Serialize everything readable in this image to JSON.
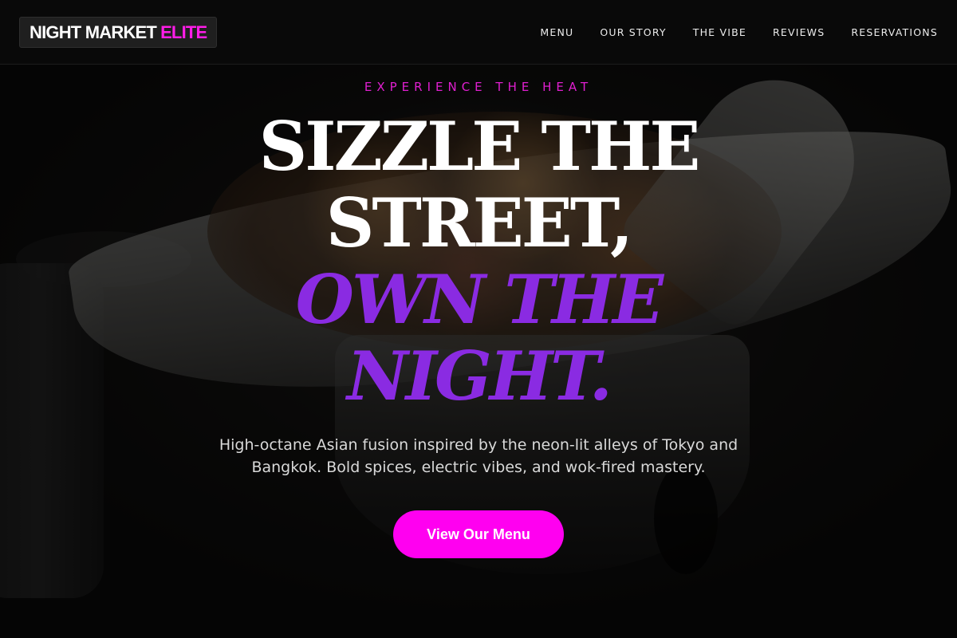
{
  "header": {
    "logo_text": "NIGHT MARKET",
    "logo_accent": "ELITE",
    "nav": [
      {
        "label": "MENU"
      },
      {
        "label": "OUR STORY"
      },
      {
        "label": "THE VIBE"
      },
      {
        "label": "REVIEWS"
      },
      {
        "label": "RESERVATIONS"
      }
    ]
  },
  "hero": {
    "eyebrow": "EXPERIENCE THE HEAT",
    "headline_line1": "SIZZLE THE",
    "headline_line2": "STREET,",
    "headline_accent_line1": "OWN THE",
    "headline_accent_line2": "NIGHT.",
    "subtext": "High-octane Asian fusion inspired by the neon-lit alleys of Tokyo and Bangkok. Bold spices, electric vibes, and wok-fired mastery.",
    "cta_label": "View Our Menu"
  },
  "colors": {
    "brand_magenta": "#ff00f0",
    "eyebrow_magenta": "#e01fd0",
    "headline_purple": "#8a2be2",
    "background": "#0a0a0a"
  },
  "icons": {
    "hero_background": "dish-photo-background"
  }
}
